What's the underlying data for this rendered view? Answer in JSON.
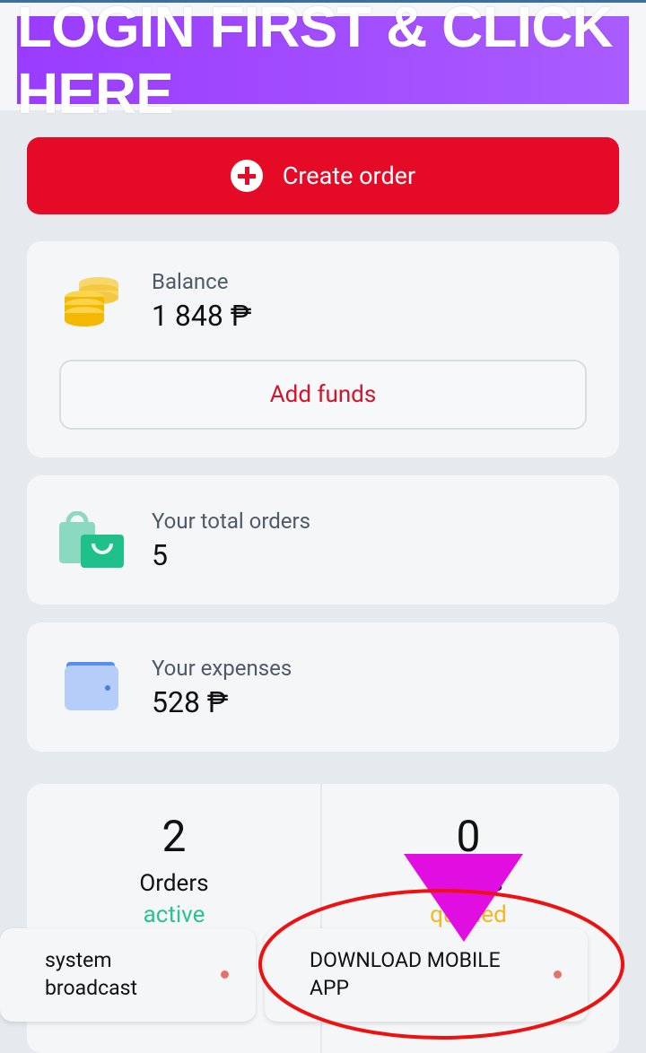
{
  "banner": {
    "text": "LOGIN FIRST & CLICK HERE"
  },
  "create_order": {
    "label": "Create order"
  },
  "balance": {
    "label": "Balance",
    "value": "1 848 ₱",
    "add_funds": "Add funds"
  },
  "orders": {
    "label": "Your total orders",
    "value": "5"
  },
  "expenses": {
    "label": "Your expenses",
    "value": "528 ₱"
  },
  "stats": {
    "left": {
      "number": "2",
      "label": "Orders",
      "status": "active"
    },
    "right": {
      "number": "0",
      "label": "Orders",
      "status": "queued"
    }
  },
  "toasts": {
    "system": "system\nbroadcast",
    "download": "DOWNLOAD MOBILE\nAPP"
  },
  "colors": {
    "accent_red": "#e50b27",
    "active_green": "#2ec08f",
    "queued_yellow": "#f2b81d",
    "banner_purple": "#9a3cff"
  }
}
